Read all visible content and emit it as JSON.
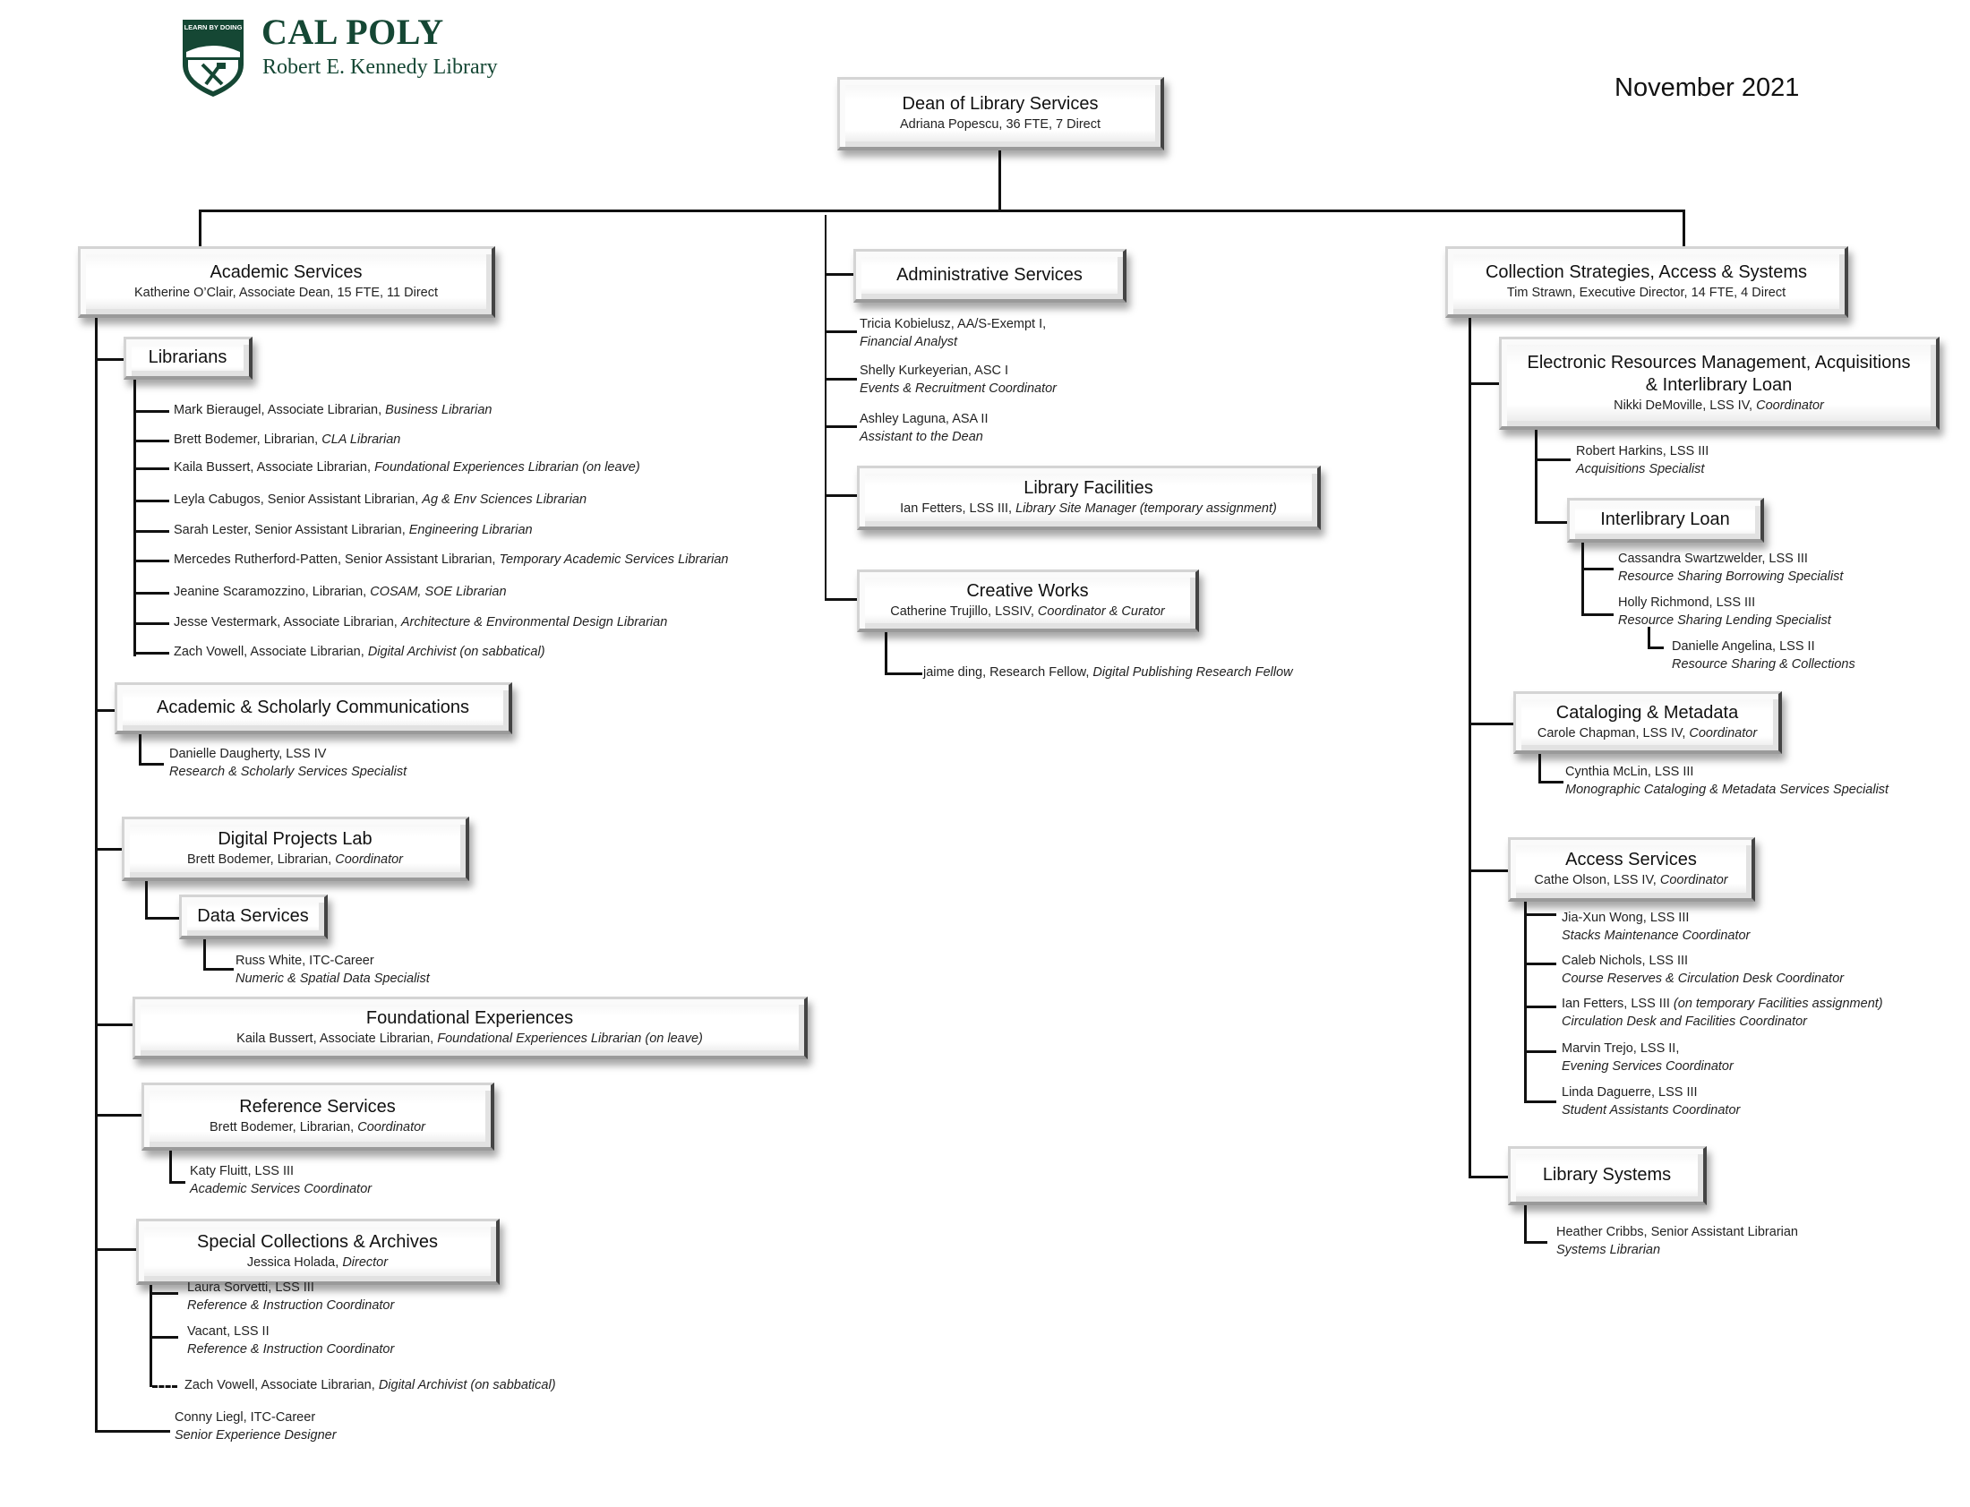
{
  "header": {
    "logo": {
      "shield_text": "LEARN BY DOING",
      "wordmark": "CAL POLY",
      "subtitle": "Robert E. Kennedy Library",
      "color": "#154734"
    },
    "date": "November 2021"
  },
  "dean": {
    "title": "Dean of Library Services",
    "sub": "Adriana Popescu, 36 FTE,  7 Direct"
  },
  "academic": {
    "title": "Academic Services",
    "sub": "Katherine O’Clair, Associate Dean, 15 FTE, 11 Direct",
    "librarians": {
      "title": "Librarians",
      "people": [
        {
          "name": "Mark Bieraugel, Associate Librarian, ",
          "role": "Business Librarian"
        },
        {
          "name": "Brett Bodemer, Librarian, ",
          "role": "CLA Librarian"
        },
        {
          "name": "Kaila Bussert, Associate Librarian, ",
          "role": "Foundational Experiences Librarian (on leave)"
        },
        {
          "name": "Leyla Cabugos, Senior Assistant Librarian, ",
          "role": "Ag & Env Sciences Librarian"
        },
        {
          "name": "Sarah Lester, Senior Assistant Librarian, ",
          "role": "Engineering Librarian"
        },
        {
          "name": "Mercedes Rutherford-Patten, Senior Assistant Librarian, ",
          "role": "Temporary Academic Services Librarian"
        },
        {
          "name": "Jeanine Scaramozzino, Librarian, ",
          "role": "COSAM, SOE Librarian"
        },
        {
          "name": "Jesse Vestermark, Associate Librarian, ",
          "role": "Architecture & Environmental Design Librarian"
        },
        {
          "name": "Zach Vowell, Associate Librarian, ",
          "role": "Digital Archivist (on sabbatical)"
        }
      ]
    },
    "scholarly": {
      "title": "Academic & Scholarly Communications",
      "person": {
        "name": "Danielle Daugherty, LSS IV",
        "role": "Research & Scholarly Services Specialist"
      }
    },
    "dpl": {
      "title": "Digital Projects Lab",
      "sub_name": "Brett Bodemer, Librarian, ",
      "sub_role": "Coordinator"
    },
    "data": {
      "title": "Data Services",
      "person": {
        "name": "Russ White, ITC-Career",
        "role": "Numeric & Spatial Data Specialist"
      }
    },
    "foundational": {
      "title": "Foundational Experiences",
      "sub_name": "Kaila Bussert, Associate Librarian, ",
      "sub_role": "Foundational Experiences Librarian (on leave)"
    },
    "reference": {
      "title": "Reference Services",
      "sub_name": "Brett Bodemer, Librarian, ",
      "sub_role": "Coordinator",
      "person": {
        "name": "Katy Fluitt, LSS III",
        "role": "Academic Services Coordinator"
      }
    },
    "special": {
      "title": "Special Collections & Archives",
      "sub_name": "Jessica Holada, ",
      "sub_role": "Director",
      "people": [
        {
          "name": "Laura Sorvetti, LSS III",
          "role": "Reference & Instruction Coordinator"
        },
        {
          "name": "Vacant, LSS II",
          "role": "Reference & Instruction Coordinator"
        }
      ],
      "dotted": {
        "name": "Zach Vowell, Associate Librarian, ",
        "role": "Digital Archivist (on sabbatical)"
      }
    },
    "conny": {
      "name": "Conny Liegl, ITC-Career",
      "role": "Senior Experience Designer"
    }
  },
  "admin": {
    "title": "Administrative Services",
    "people": [
      {
        "name": "Tricia Kobielusz, AA/S-Exempt I,",
        "role": "Financial Analyst"
      },
      {
        "name": "Shelly Kurkeyerian, ASC I",
        "role": "Events & Recruitment Coordinator"
      },
      {
        "name": "Ashley Laguna, ASA II",
        "role": "Assistant to the Dean"
      }
    ],
    "facilities": {
      "title": "Library Facilities",
      "sub_name": "Ian Fetters, LSS III, ",
      "sub_role": "Library Site Manager (temporary assignment)"
    },
    "creative": {
      "title": "Creative Works",
      "sub_name": "Catherine Trujillo, LSSIV, ",
      "sub_role": "Coordinator & Curator",
      "person": {
        "name": "jaime ding, Research Fellow, ",
        "role": "Digital Publishing Research Fellow"
      }
    }
  },
  "collections": {
    "title": "Collection Strategies, Access & Systems",
    "sub": "Tim Strawn, Executive Director, 14 FTE, 4 Direct",
    "erm": {
      "title1": "Electronic Resources Management, Acquisitions",
      "title2": "& Interlibrary Loan",
      "sub_name": "Nikki DeMoville, LSS IV, ",
      "sub_role": "Coordinator",
      "person": {
        "name": "Robert Harkins, LSS III",
        "role": "Acquisitions Specialist"
      },
      "ill": {
        "title": "Interlibrary Loan",
        "people": [
          {
            "name": "Cassandra Swartzwelder, LSS III",
            "role": "Resource Sharing Borrowing Specialist"
          },
          {
            "name": "Holly Richmond, LSS III",
            "role": "Resource Sharing Lending Specialist"
          }
        ],
        "sub_person": {
          "name": "Danielle Angelina, LSS II",
          "role": "Resource Sharing & Collections"
        }
      }
    },
    "cataloging": {
      "title": "Cataloging & Metadata",
      "sub_name": "Carole Chapman, LSS IV, ",
      "sub_role": "Coordinator",
      "person": {
        "name": "Cynthia McLin, LSS III",
        "role": "Monographic Cataloging & Metadata Services Specialist"
      }
    },
    "access": {
      "title": "Access Services",
      "sub_name": "Cathe Olson, LSS IV, ",
      "sub_role": "Coordinator",
      "people": [
        {
          "name": "Jia-Xun Wong, LSS III",
          "role": "Stacks Maintenance Coordinator"
        },
        {
          "name": "Caleb Nichols, LSS III",
          "role": "Course Reserves & Circulation Desk Coordinator"
        },
        {
          "name": "Ian Fetters, LSS III ",
          "note": "(on temporary Facilities assignment)",
          "role": "Circulation Desk and Facilities Coordinator"
        },
        {
          "name": "Marvin Trejo, LSS II,",
          "role": "Evening Services Coordinator"
        },
        {
          "name": "Linda Daguerre, LSS III",
          "role": "Student Assistants Coordinator"
        }
      ]
    },
    "systems": {
      "title": "Library Systems",
      "person": {
        "name": "Heather Cribbs, Senior Assistant Librarian",
        "role": "Systems Librarian"
      }
    }
  }
}
